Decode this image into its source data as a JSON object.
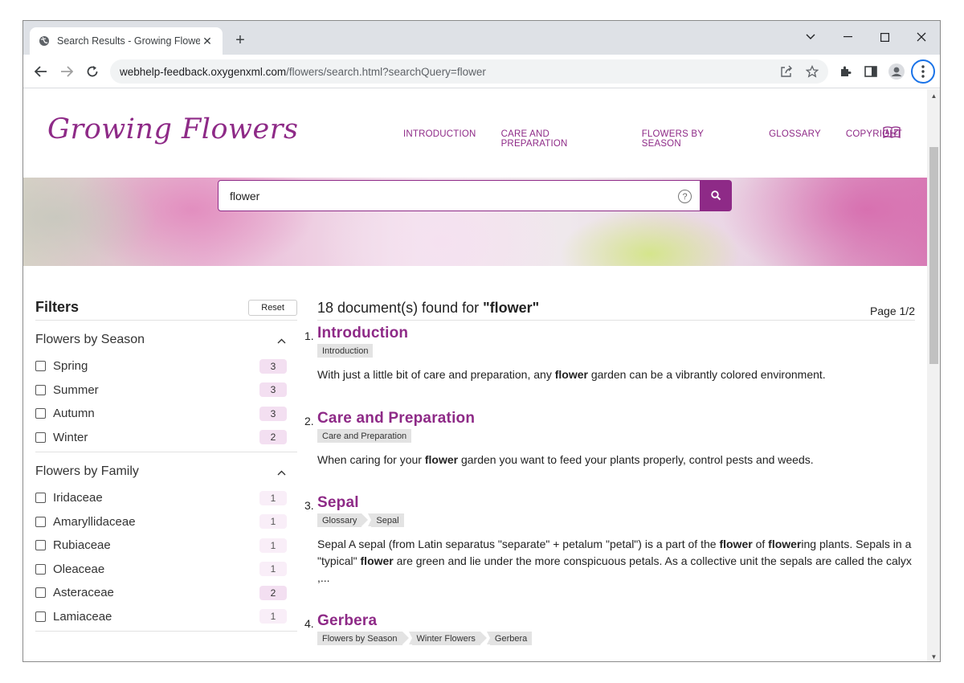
{
  "browser": {
    "tab_title": "Search Results - Growing Flowers",
    "url_host": "webhelp-feedback.oxygenxml.com",
    "url_path": "/flowers/search.html?searchQuery=flower"
  },
  "site": {
    "logo": "Growing Flowers",
    "nav": [
      "INTRODUCTION",
      "CARE AND PREPARATION",
      "FLOWERS BY SEASON",
      "GLOSSARY",
      "COPYRIGHT"
    ],
    "accent": "#8e2a87"
  },
  "search": {
    "query": "flower",
    "help_glyph": "?"
  },
  "filters": {
    "title": "Filters",
    "reset_label": "Reset",
    "groups": [
      {
        "title": "Flowers by Season",
        "items": [
          {
            "label": "Spring",
            "count": "3"
          },
          {
            "label": "Summer",
            "count": "3"
          },
          {
            "label": "Autumn",
            "count": "3"
          },
          {
            "label": "Winter",
            "count": "2"
          }
        ]
      },
      {
        "title": "Flowers by Family",
        "items": [
          {
            "label": "Iridaceae",
            "count": "1"
          },
          {
            "label": "Amaryllidaceae",
            "count": "1"
          },
          {
            "label": "Rubiaceae",
            "count": "1"
          },
          {
            "label": "Oleaceae",
            "count": "1"
          },
          {
            "label": "Asteraceae",
            "count": "2"
          },
          {
            "label": "Lamiaceae",
            "count": "1"
          }
        ]
      }
    ]
  },
  "results": {
    "summary_prefix": "18 document(s) found for ",
    "summary_query": "\"flower\"",
    "page": "Page 1/2",
    "items": [
      {
        "num": "1.",
        "title": "Introduction",
        "crumbs": [
          "Introduction"
        ],
        "snippet_parts": [
          {
            "t": "With just a little bit of care and preparation, any ",
            "b": false
          },
          {
            "t": "flower",
            "b": true
          },
          {
            "t": " garden can be a vibrantly colored environment.",
            "b": false
          }
        ]
      },
      {
        "num": "2.",
        "title": "Care and Preparation",
        "crumbs": [
          "Care and Preparation"
        ],
        "snippet_parts": [
          {
            "t": "When caring for your ",
            "b": false
          },
          {
            "t": "flower",
            "b": true
          },
          {
            "t": " garden you want to feed your plants properly, control pests and weeds.",
            "b": false
          }
        ]
      },
      {
        "num": "3.",
        "title": "Sepal",
        "crumbs": [
          "Glossary",
          "Sepal"
        ],
        "snippet_parts": [
          {
            "t": "Sepal A sepal (from Latin separatus \"separate\" + petalum \"petal\") is a part of the ",
            "b": false
          },
          {
            "t": "flower",
            "b": true
          },
          {
            "t": " of ",
            "b": false
          },
          {
            "t": "flower",
            "b": true
          },
          {
            "t": "ing plants. Sepals in a \"typical\" ",
            "b": false
          },
          {
            "t": "flower",
            "b": true
          },
          {
            "t": " are green and lie under the more conspicuous petals. As a collective unit the sepals are called the calyx ,...",
            "b": false
          }
        ]
      },
      {
        "num": "4.",
        "title": "Gerbera",
        "crumbs": [
          "Flowers by Season",
          "Winter Flowers",
          "Gerbera"
        ],
        "snippet_parts": []
      }
    ]
  }
}
